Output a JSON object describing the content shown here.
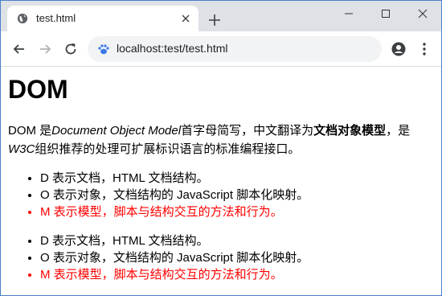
{
  "tab": {
    "title": "test.html"
  },
  "omnibox": {
    "url": "localhost:test/test.html"
  },
  "page": {
    "heading": "DOM",
    "paragraph": {
      "p1": "DOM 是",
      "i1": "Document Object Model",
      "p2": "首字母简写，中文翻译为",
      "b1": "文档对象模型",
      "p3": "，是",
      "i2": "W3C",
      "p4": "组织推荐的处理可扩展标识语言的标准编程接口。"
    },
    "list1": [
      "D 表示文档，HTML 文档结构。",
      "O 表示对象，文档结构的 JavaScript 脚本化映射。",
      "M 表示模型，脚本与结构交互的方法和行为。"
    ],
    "list2": [
      "D 表示文档，HTML 文档结构。",
      "O 表示对象，文档结构的 JavaScript 脚本化映射。",
      "M 表示模型，脚本与结构交互的方法和行为。"
    ],
    "accent_red": "#ff0000"
  }
}
